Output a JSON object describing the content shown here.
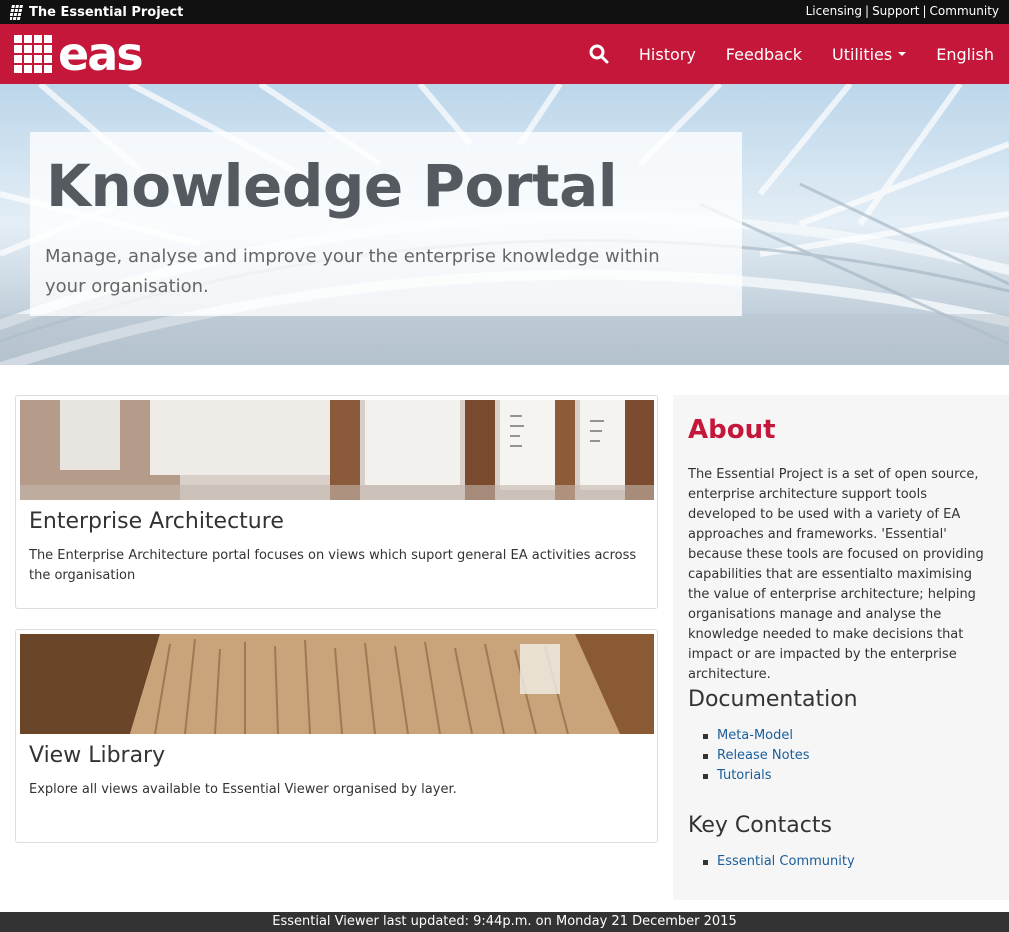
{
  "topbar": {
    "brand": "The Essential Project",
    "links": [
      {
        "label": "Licensing"
      },
      {
        "label": "Support"
      },
      {
        "label": "Community"
      }
    ],
    "separator": "|"
  },
  "header": {
    "logo_text": "eas",
    "nav": {
      "history": "History",
      "feedback": "Feedback",
      "utilities": "Utilities",
      "language": "English"
    },
    "brand_color": "#c4173a"
  },
  "hero": {
    "title": "Knowledge Portal",
    "subtitle": "Manage, analyse and improve your the enterprise knowledge within your organisation."
  },
  "cards": [
    {
      "title": "Enterprise Architecture",
      "text": "The Enterprise Architecture portal focuses on views which suport general EA activities across the organisation"
    },
    {
      "title": "View Library",
      "text": "Explore all views available to Essential Viewer organised by layer."
    }
  ],
  "sidebar": {
    "about_title": "About",
    "about_text": "The Essential Project is a set of open source, enterprise architecture support tools developed to be used with a variety of EA approaches and frameworks. 'Essential' because these tools are focused on providing capabilities that are essentialto maximising the value of enterprise architecture; helping organisations manage and analyse the knowledge needed to make decisions that impact or are impacted by the enterprise architecture.",
    "documentation_title": "Documentation",
    "documentation_links": [
      {
        "label": "Meta-Model"
      },
      {
        "label": "Release Notes"
      },
      {
        "label": "Tutorials"
      }
    ],
    "contacts_title": "Key Contacts",
    "contacts_links": [
      {
        "label": "Essential Community"
      }
    ]
  },
  "footer": {
    "text": "Essential Viewer last updated: 9:44p.m. on Monday 21 December 2015"
  }
}
